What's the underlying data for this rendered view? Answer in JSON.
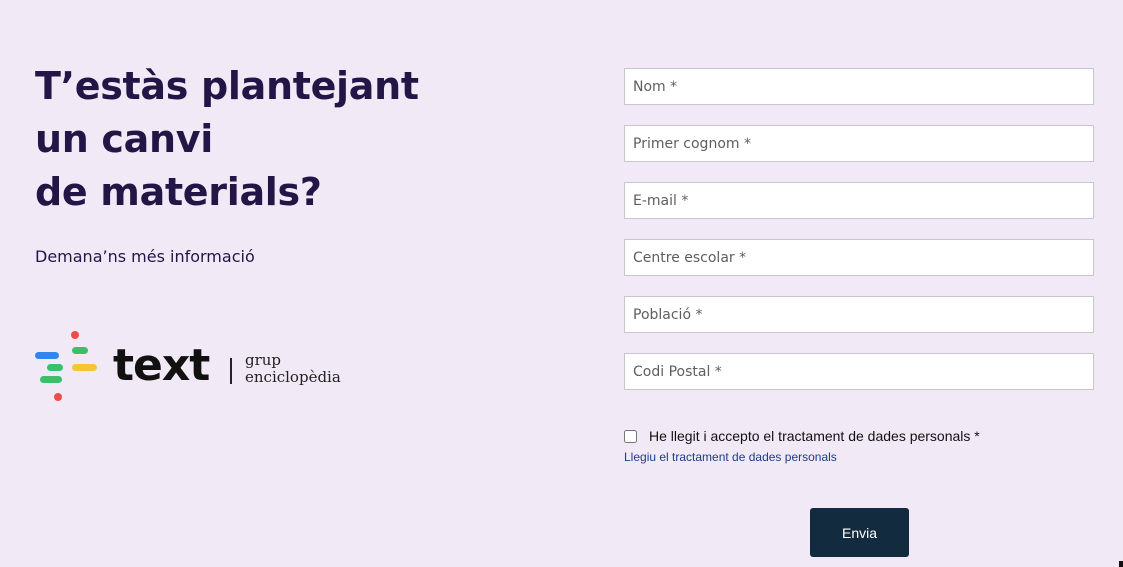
{
  "hero": {
    "headline": [
      "T’estàs plantejant",
      "un canvi",
      "de materials?"
    ],
    "subtitle": "Demana’ns més informació"
  },
  "logo": {
    "wordmark": "text",
    "group_line1": "grup",
    "group_line2": "enciclopèdia",
    "icon": "text-logo-dots-icon",
    "colors": {
      "red": "#f04a4a",
      "blue": "#2f86f2",
      "green": "#3bbf6a",
      "yellow": "#f7c531"
    }
  },
  "form": {
    "fields": [
      {
        "placeholder": "Nom *",
        "value": ""
      },
      {
        "placeholder": "Primer cognom *",
        "value": ""
      },
      {
        "placeholder": "E-mail *",
        "value": ""
      },
      {
        "placeholder": "Centre escolar *",
        "value": ""
      },
      {
        "placeholder": "Població *",
        "value": ""
      },
      {
        "placeholder": "Codi Postal *",
        "value": ""
      }
    ],
    "consent_label": "He llegit i accepto el tractament de dades personals *",
    "consent_checked": false,
    "privacy_link": "Llegiu el tractament de dades personals",
    "submit_label": "Envia"
  },
  "colors": {
    "background": "#f1e9f6",
    "headline": "#231646",
    "button": "#132b3f",
    "link": "#1a3d8f"
  }
}
